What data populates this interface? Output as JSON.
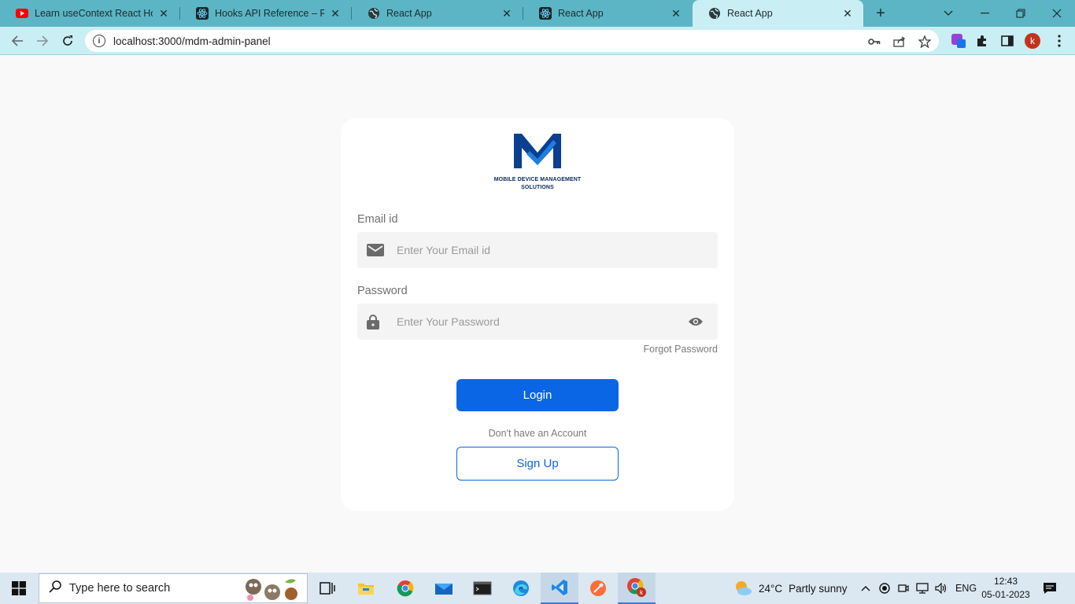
{
  "browser": {
    "tabs": [
      {
        "title": "Learn useContext React Hook",
        "favicon": "youtube-icon",
        "active": false
      },
      {
        "title": "Hooks API Reference – React",
        "favicon": "react-icon",
        "active": false
      },
      {
        "title": "React App",
        "favicon": "globe-icon",
        "active": false
      },
      {
        "title": "React App",
        "favicon": "react-icon",
        "active": false
      },
      {
        "title": "React App",
        "favicon": "globe-icon",
        "active": true
      }
    ],
    "url": "localhost:3000/mdm-admin-panel"
  },
  "login": {
    "logo_caption_line1": "MOBILE DEVICE MANAGEMENT",
    "logo_caption_line2": "SOLUTIONS",
    "email_label": "Email id",
    "email_placeholder": "Enter Your Email id",
    "email_value": "",
    "password_label": "Password",
    "password_placeholder": "Enter Your Password",
    "password_value": "",
    "forgot_password": "Forgot Password",
    "login_button": "Login",
    "no_account_text": "Don't have an Account",
    "signup_button": "Sign Up",
    "accent_color": "#0a66e4"
  },
  "taskbar": {
    "search_placeholder": "Type here to search",
    "weather_temp": "24°C",
    "weather_desc": "Partly sunny",
    "language": "ENG",
    "time": "12:43",
    "date": "05-01-2023"
  }
}
